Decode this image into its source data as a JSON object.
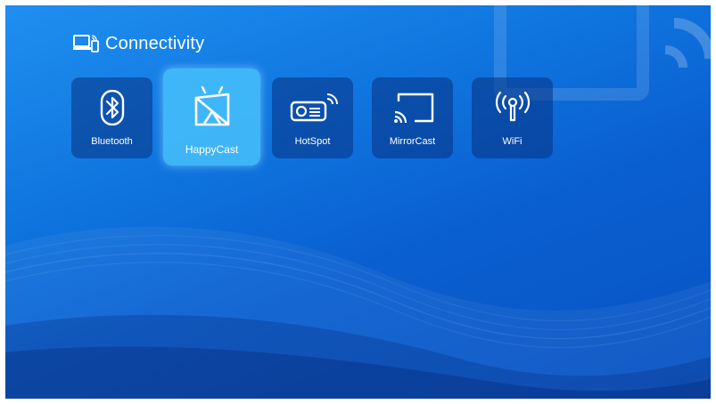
{
  "header": {
    "title": "Connectivity",
    "icon": "connectivity-icon"
  },
  "tiles": [
    {
      "label": "Bluetooth",
      "icon": "bluetooth-icon",
      "selected": false
    },
    {
      "label": "HappyCast",
      "icon": "happycast-icon",
      "selected": true
    },
    {
      "label": "HotSpot",
      "icon": "projector-hotspot-icon",
      "selected": false
    },
    {
      "label": "MirrorCast",
      "icon": "cast-screen-icon",
      "selected": false
    },
    {
      "label": "WiFi",
      "icon": "wifi-antenna-icon",
      "selected": false
    }
  ],
  "colors": {
    "background": "#0f74de",
    "tile": "#0a3a8a",
    "selected_tile": "#46bef9"
  }
}
